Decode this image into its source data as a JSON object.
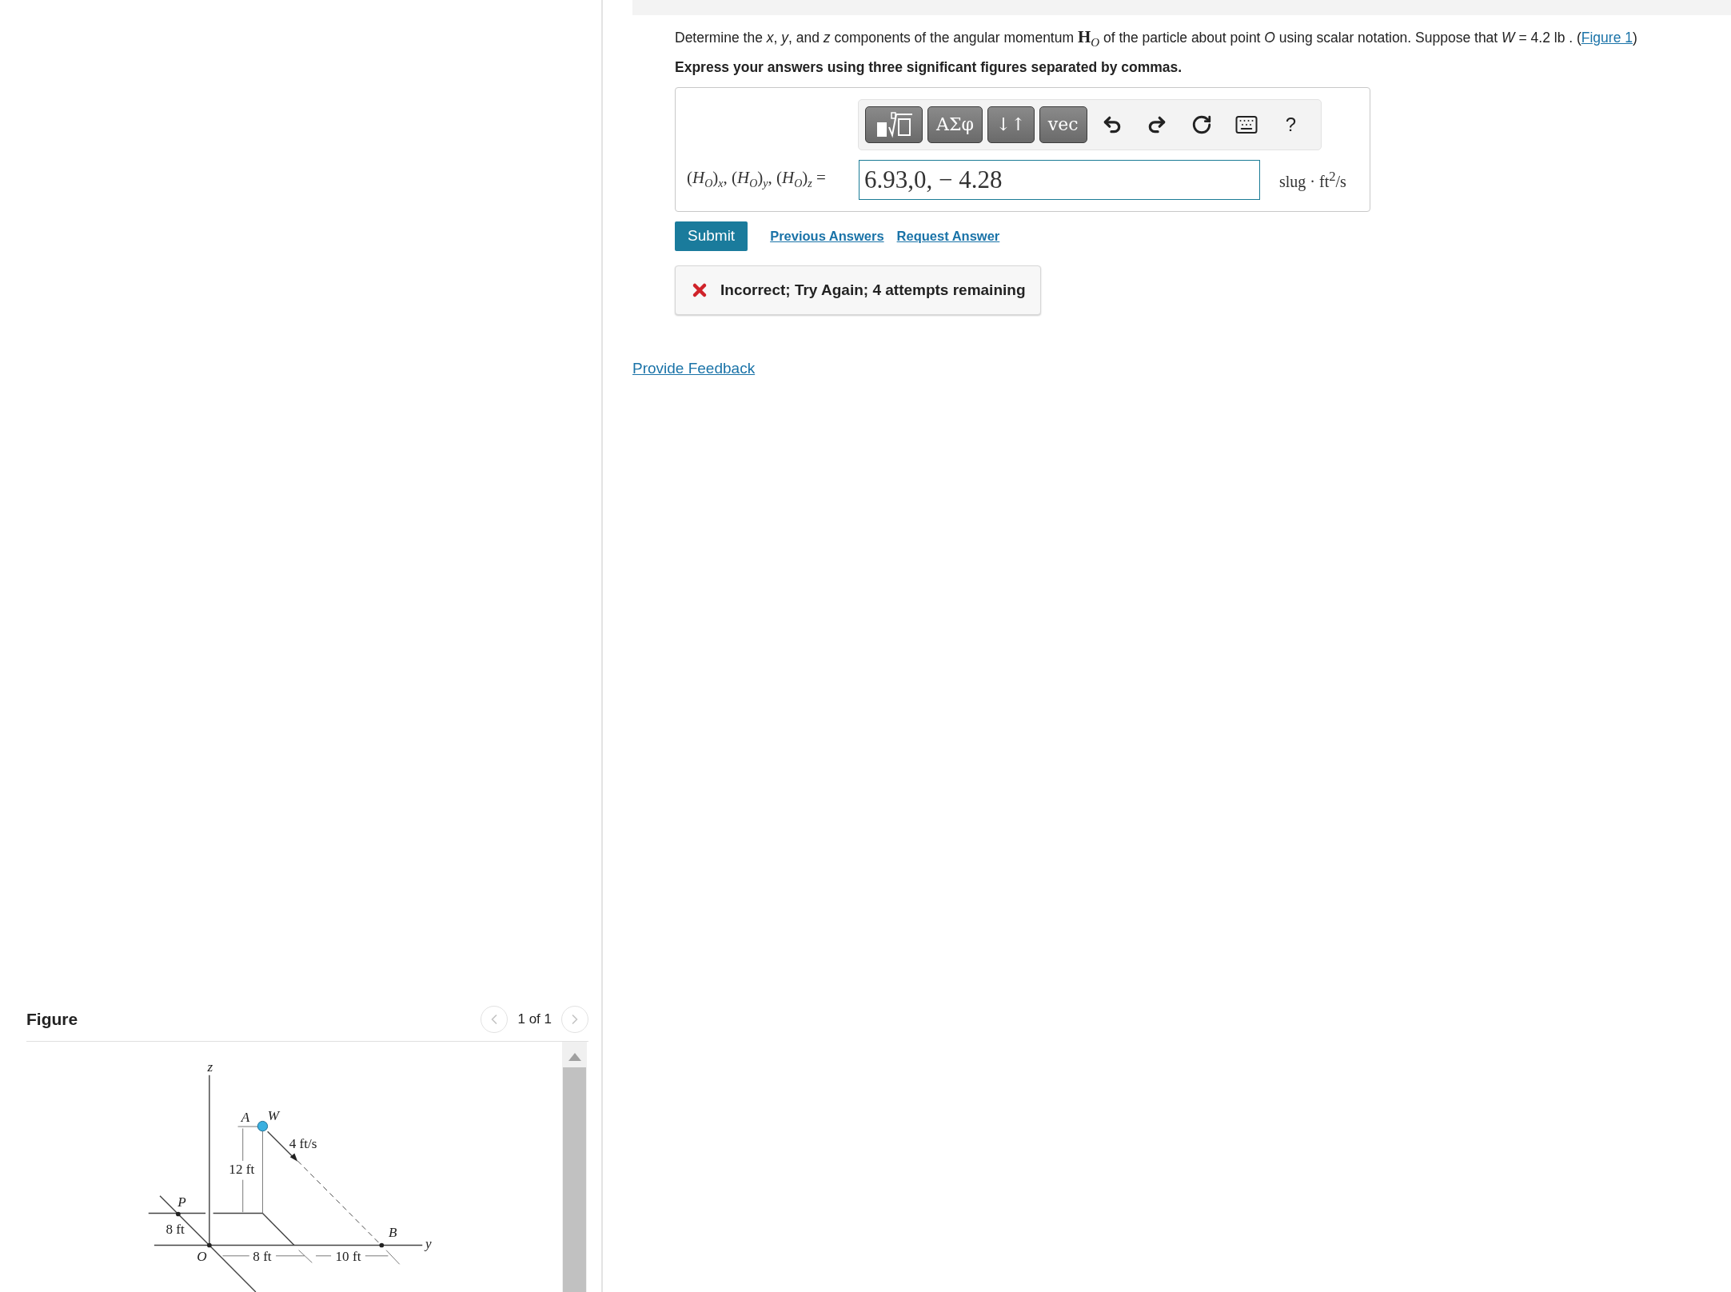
{
  "question": {
    "prompt": "Determine the *x*, *y*, and *z* components of the angular momentum **H**$_{O}$ of the particle about point *O* using scalar notation. Suppose that *W* = 4.2  lb . (",
    "figure_link": "Figure 1",
    "prompt_end": ")",
    "instruction": "Express your answers using three significant figures separated by commas."
  },
  "toolbar": [
    {
      "kind": "template"
    },
    {
      "kind": "text",
      "label": "ΑΣφ"
    },
    {
      "kind": "text",
      "label": "↓↑"
    },
    {
      "kind": "text",
      "label": "vec"
    },
    {
      "kind": "undo"
    },
    {
      "kind": "redo"
    },
    {
      "kind": "reset"
    },
    {
      "kind": "keyboard"
    },
    {
      "kind": "plain",
      "label": "?"
    }
  ],
  "answer": {
    "label": "(*H*$_{O}$)$_{x}$, (*H*$_{O}$)$_{y}$, (*H*$_{O}$)$_{z}$ =",
    "value": "6.93,0, − 4.28",
    "units": "slug · ft$^{2}$/s"
  },
  "actions": {
    "submit": "Submit",
    "links": [
      "Previous Answers",
      "Request Answer"
    ]
  },
  "feedback": {
    "correct": false,
    "message": "Incorrect; Try Again; 4 attempts remaining"
  },
  "provide_feedback": "Provide Feedback",
  "figure": {
    "title": "Figure",
    "pager": "1 of 1",
    "prev_disabled": true,
    "next_disabled": true,
    "labels": [
      "z",
      "A",
      "W",
      "4 ft/s",
      "12 ft",
      "P",
      "8 ft",
      "B",
      "y",
      "O",
      "8 ft",
      "10 ft"
    ]
  }
}
